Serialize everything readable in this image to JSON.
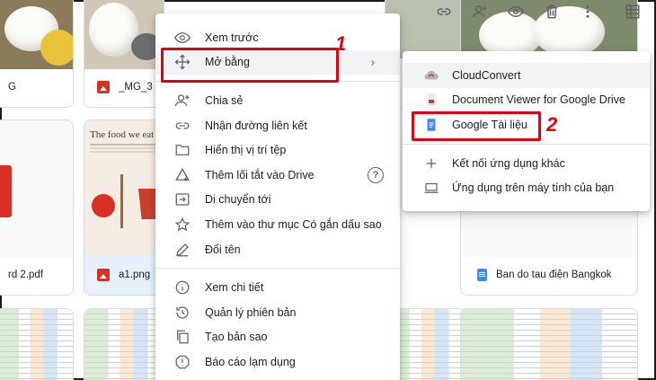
{
  "toolbar": {
    "icons": [
      "link-icon",
      "add-person-icon",
      "preview-eye-icon",
      "trash-icon",
      "more-vert-icon",
      "grid-view-icon"
    ]
  },
  "files": {
    "row1": [
      {
        "name": "G",
        "type": "image"
      },
      {
        "name": "_MG_3",
        "type": "image"
      }
    ],
    "row2": [
      {
        "name": "rd 2.pdf",
        "type": "pdf"
      },
      {
        "name": "a1.png",
        "type": "image",
        "thumb_title": "The food we eat"
      },
      {
        "name": "Ban do tau điện Bangkok",
        "type": "doc"
      }
    ]
  },
  "context_menu": {
    "items": [
      {
        "label": "Xem trước",
        "icon": "eye-icon"
      },
      {
        "label": "Mở bằng",
        "icon": "move-arrows-icon",
        "has_submenu": true
      },
      {
        "label": "Chia sẻ",
        "icon": "add-person-icon"
      },
      {
        "label": "Nhận đường liên kết",
        "icon": "link-icon"
      },
      {
        "label": "Hiển thị vị trí tệp",
        "icon": "folder-icon"
      },
      {
        "label": "Thêm lối tắt vào Drive",
        "icon": "add-shortcut-icon",
        "has_help": true
      },
      {
        "label": "Di chuyển tới",
        "icon": "move-to-icon"
      },
      {
        "label": "Thêm vào thư mục Có gắn dấu sao",
        "icon": "star-icon"
      },
      {
        "label": "Đổi tên",
        "icon": "pencil-icon"
      },
      {
        "label": "Xem chi tiết",
        "icon": "info-icon"
      },
      {
        "label": "Quản lý phiên bản",
        "icon": "history-icon"
      },
      {
        "label": "Tạo bản sao",
        "icon": "copy-icon"
      },
      {
        "label": "Báo cáo lạm dụng",
        "icon": "report-icon"
      }
    ]
  },
  "submenu": {
    "items": [
      {
        "label": "CloudConvert",
        "icon": "cloudconvert-icon"
      },
      {
        "label": "Document Viewer for Google Drive",
        "icon": "document-viewer-icon"
      },
      {
        "label": "Google Tài liệu",
        "icon": "google-docs-icon"
      },
      {
        "label": "Kết nối ứng dụng khác",
        "icon": "plus-icon"
      },
      {
        "label": "Ứng dụng trên máy tính của bạn",
        "icon": "laptop-icon"
      }
    ]
  },
  "annotations": {
    "step1": "1",
    "step2": "2"
  },
  "colors": {
    "highlight": "#e3000f",
    "docs_blue": "#4285f4",
    "image_red": "#d93025"
  }
}
